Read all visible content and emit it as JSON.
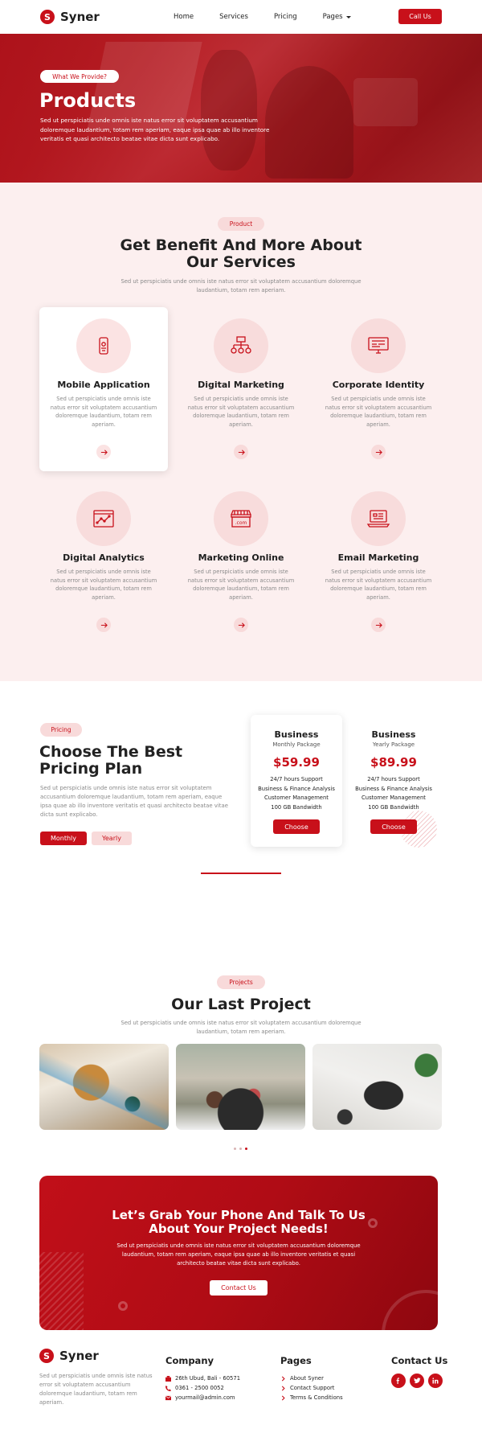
{
  "brand": {
    "name": "Syner",
    "mark": "S"
  },
  "nav": {
    "items": [
      "Home",
      "Services",
      "Pricing",
      "Pages"
    ],
    "cta": "Call Us"
  },
  "hero": {
    "tag": "What We Provide?",
    "title": "Products",
    "description": "Sed ut perspiciatis unde omnis iste natus error sit voluptatem accusantium doloremque laudantium, totam rem aperiam, eaque ipsa quae ab illo inventore veritatis et quasi architecto beatae vitae dicta sunt explicabo."
  },
  "services": {
    "tag": "Product",
    "title_line1": "Get Benefit And More About",
    "title_line2": "Our Services",
    "subtitle": "Sed ut perspiciatis unde omnis iste natus error sit voluptatem accusantium doloremque laudantium, totam rem aperiam.",
    "items": [
      {
        "title": "Mobile Application",
        "desc": "Sed ut perspiciatis unde omnis iste natus error sit voluptatem accusantium doloremque laudantium, totam rem aperiam.",
        "icon": "mobile-icon"
      },
      {
        "title": "Digital Marketing",
        "desc": "Sed ut perspiciatis unde omnis iste natus error sit voluptatem accusantium doloremque laudantium, totam rem aperiam.",
        "icon": "sitemap-icon"
      },
      {
        "title": "Corporate Identity",
        "desc": "Sed ut perspiciatis unde omnis iste natus error sit voluptatem accusantium doloremque laudantium, totam rem aperiam.",
        "icon": "monitor-icon"
      },
      {
        "title": "Digital Analytics",
        "desc": "Sed ut perspiciatis unde omnis iste natus error sit voluptatem accusantium doloremque laudantium, totam rem aperiam.",
        "icon": "analytics-icon"
      },
      {
        "title": "Marketing Online",
        "desc": "Sed ut perspiciatis unde omnis iste natus error sit voluptatem accusantium doloremque laudantium, totam rem aperiam.",
        "icon": "store-icon"
      },
      {
        "title": "Email Marketing",
        "desc": "Sed ut perspiciatis unde omnis iste natus error sit voluptatem accusantium doloremque laudantium, totam rem aperiam.",
        "icon": "laptop-mail-icon"
      }
    ],
    "store_label": ".com"
  },
  "pricing": {
    "tag": "Pricing",
    "title_line1": "Choose The Best",
    "title_line2": "Pricing Plan",
    "description": "Sed ut perspiciatis unde omnis iste natus error sit voluptatem accusantium doloremque laudantium, totam rem aperiam, eaque ipsa quae ab illo inventore veritatis et quasi architecto beatae vitae dicta sunt explicabo.",
    "toggle_monthly": "Monthly",
    "toggle_yearly": "Yearly",
    "plans": [
      {
        "name": "Business",
        "period": "Monthly Package",
        "price": "$59.99",
        "features": [
          "24/7 hours Support",
          "Business & Finance Analysis",
          "Customer Management",
          "100 GB Bandwidth"
        ],
        "cta": "Choose"
      },
      {
        "name": "Business",
        "period": "Yearly Package",
        "price": "$89.99",
        "features": [
          "24/7 hours Support",
          "Business & Finance Analysis",
          "Customer Management",
          "100 GB Bandwidth"
        ],
        "cta": "Choose"
      }
    ]
  },
  "projects": {
    "tag": "Projects",
    "title": "Our Last Project",
    "subtitle": "Sed ut perspiciatis unde omnis iste natus error sit voluptatem accusantium doloremque laudantium, totam rem aperiam."
  },
  "cta": {
    "title_line1": "Let’s Grab Your Phone And Talk To Us",
    "title_line2": "About Your Project Needs!",
    "description": "Sed ut perspiciatis unde omnis iste natus error sit voluptatem accusantium doloremque laudantium, totam rem aperiam, eaque ipsa quae ab illo inventore veritatis et quasi architecto beatae vitae dicta sunt explicabo.",
    "button": "Contact Us"
  },
  "footer": {
    "description": "Sed ut perspiciatis unde omnis iste natus error sit voluptatem accusantium doloremque laudantium, totam rem aperiam.",
    "company_heading": "Company",
    "address": "26th Ubud, Bali - 60571",
    "phone": "0361 - 2500 0052",
    "email": "yourmail@admin.com",
    "pages_heading": "Pages",
    "pages": [
      "About Syner",
      "Contact Support",
      "Terms & Conditions"
    ],
    "contact_heading": "Contact Us",
    "social_icons": [
      "facebook-icon",
      "twitter-icon",
      "linkedin-icon"
    ]
  },
  "colors": {
    "accent": "#c8101a",
    "soft": "#fcefef",
    "pill": "#f8dada"
  }
}
